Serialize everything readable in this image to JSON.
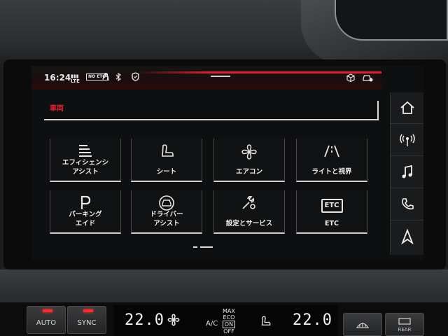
{
  "status": {
    "time": "16:24",
    "lte": "LTE",
    "etc_no": "NO ETC",
    "person_icon": "person-icon",
    "bluetooth_icon": "bluetooth-icon",
    "shield_icon": "shield-icon",
    "box_icon": "package-icon",
    "car_icon": "car-settings-icon"
  },
  "page": {
    "title": "車両"
  },
  "tiles": [
    {
      "label": "エフィシェンシ\nアシスト",
      "icon": "efficiency-icon"
    },
    {
      "label": "シート",
      "icon": "seat-icon"
    },
    {
      "label": "エアコン",
      "icon": "fan-icon"
    },
    {
      "label": "ライトと視界",
      "icon": "road-view-icon"
    },
    {
      "label": "パーキング\nエイド",
      "icon": "parking-icon"
    },
    {
      "label": "ドライバー\nアシスト",
      "icon": "driver-assist-icon"
    },
    {
      "label": "設定とサービス",
      "icon": "wrench-gear-icon"
    },
    {
      "label": "ETC",
      "icon": "etc-icon",
      "icon_text": "ETC"
    }
  ],
  "sidebar": [
    {
      "icon": "home-icon"
    },
    {
      "icon": "radio-icon"
    },
    {
      "icon": "music-icon"
    },
    {
      "icon": "phone-icon"
    },
    {
      "icon": "navigation-icon"
    }
  ],
  "climate": {
    "auto_label": "AUTO",
    "sync_label": "SYNC",
    "left_temp": "22.0",
    "right_temp": "22.0",
    "ac_label": "A/C",
    "max_label": "MAX",
    "eco_label": "ECO",
    "on_label": "ON",
    "off_label": "OFF",
    "rear_label": "REAR",
    "led_color": "#ff2a2a"
  },
  "colors": {
    "accent": "#e3212d"
  }
}
